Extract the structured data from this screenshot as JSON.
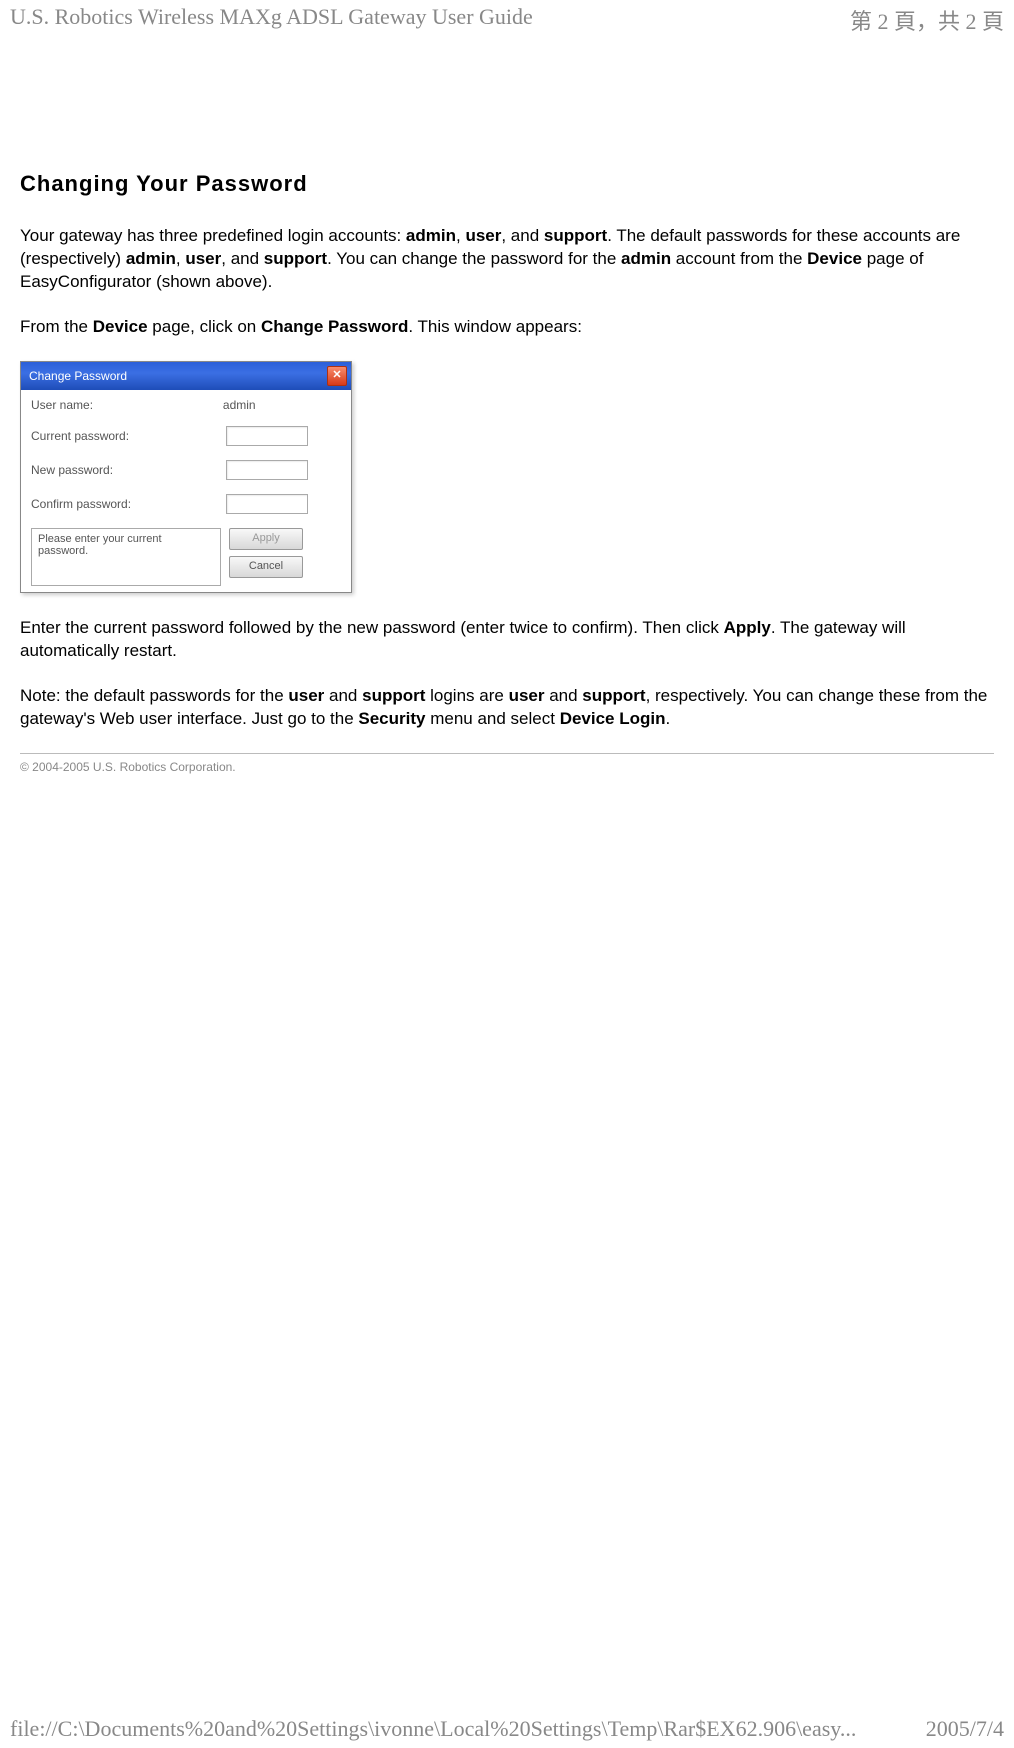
{
  "header": {
    "title": "U.S. Robotics Wireless MAXg ADSL Gateway User Guide",
    "page_info": "第 2 頁，共 2 頁"
  },
  "heading": "Changing Your Password",
  "para1": {
    "pre1": "Your gateway has three predefined login accounts: ",
    "b1": "admin",
    "sep1": ", ",
    "b2": "user",
    "sep2": ", and ",
    "b3": "support",
    "mid1": ". The default passwords for these accounts are (respectively) ",
    "b4": "admin",
    "sep3": ", ",
    "b5": "user",
    "sep4": ", and ",
    "b6": "support",
    "mid2": ". You can change the password for the ",
    "b7": "admin",
    "mid3": " account from the ",
    "b8": "Device",
    "end": " page of EasyConfigurator (shown above)."
  },
  "para2": {
    "pre": "From the ",
    "b1": "Device",
    "mid": " page, click on ",
    "b2": "Change Password",
    "end": ". This window appears:"
  },
  "dialog": {
    "title": "Change Password",
    "close_glyph": "✕",
    "username_label": "User name:",
    "username_value": "admin",
    "current_label": "Current password:",
    "new_label": "New password:",
    "confirm_label": "Confirm password:",
    "message": "Please enter your current password.",
    "apply_label": "Apply",
    "cancel_label": "Cancel"
  },
  "para3": {
    "pre": "Enter the current password followed by the new password (enter twice to confirm). Then click ",
    "b1": "Apply",
    "end": ". The gateway will automatically restart."
  },
  "para4": {
    "pre": "Note: the default passwords for the ",
    "b1": "user",
    "mid1": " and ",
    "b2": "support",
    "mid2": " logins are ",
    "b3": "user",
    "mid3": " and ",
    "b4": "support",
    "mid4": ", respectively. You can change these from the gateway's Web user interface. Just go to the ",
    "b5": "Security",
    "mid5": " menu and select ",
    "b6": "Device Login",
    "end": "."
  },
  "copyright": "© 2004-2005 U.S. Robotics Corporation.",
  "footer": {
    "path": "file://C:\\Documents%20and%20Settings\\ivonne\\Local%20Settings\\Temp\\Rar$EX62.906\\easy...",
    "date": "2005/7/4"
  }
}
